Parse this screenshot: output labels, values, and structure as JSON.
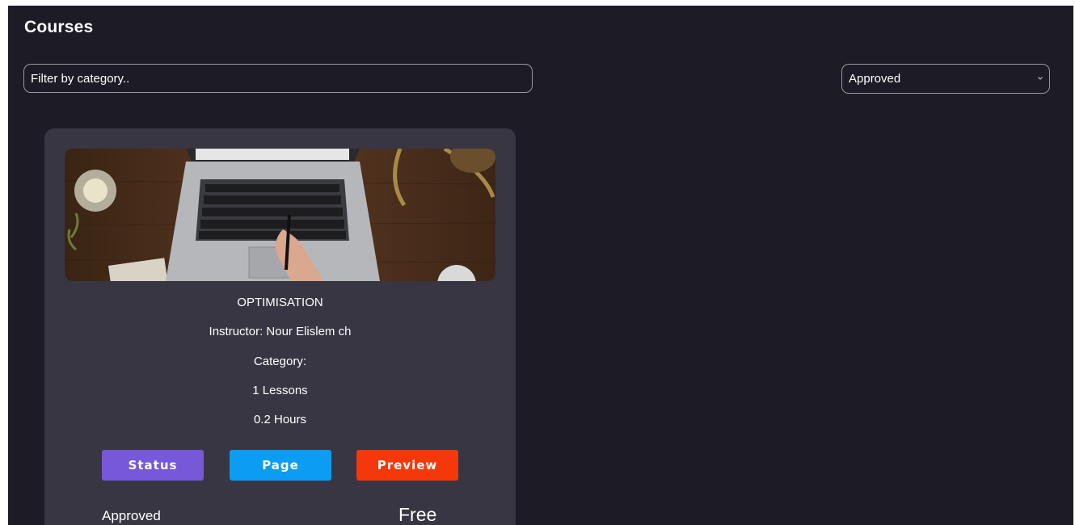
{
  "page": {
    "title": "Courses"
  },
  "filter": {
    "placeholder": "Filter by category.."
  },
  "status_filter": {
    "selected": "Approved"
  },
  "courses": [
    {
      "title": "OPTIMISATION",
      "instructor": "Instructor: Nour Elislem ch",
      "category": "Category:",
      "lessons": "1 Lessons",
      "hours": "0.2 Hours",
      "buttons": {
        "status": "Status",
        "page": "Page",
        "preview": "Preview"
      },
      "approval_status": "Approved",
      "price": "Free"
    }
  ],
  "colors": {
    "background": "#1c1b26",
    "card": "#383643",
    "status_button": "#7658d8",
    "page_button": "#0c9cf2",
    "preview_button": "#f5380a"
  },
  "icons": {
    "select_arrow": "chevron-down-icon"
  }
}
